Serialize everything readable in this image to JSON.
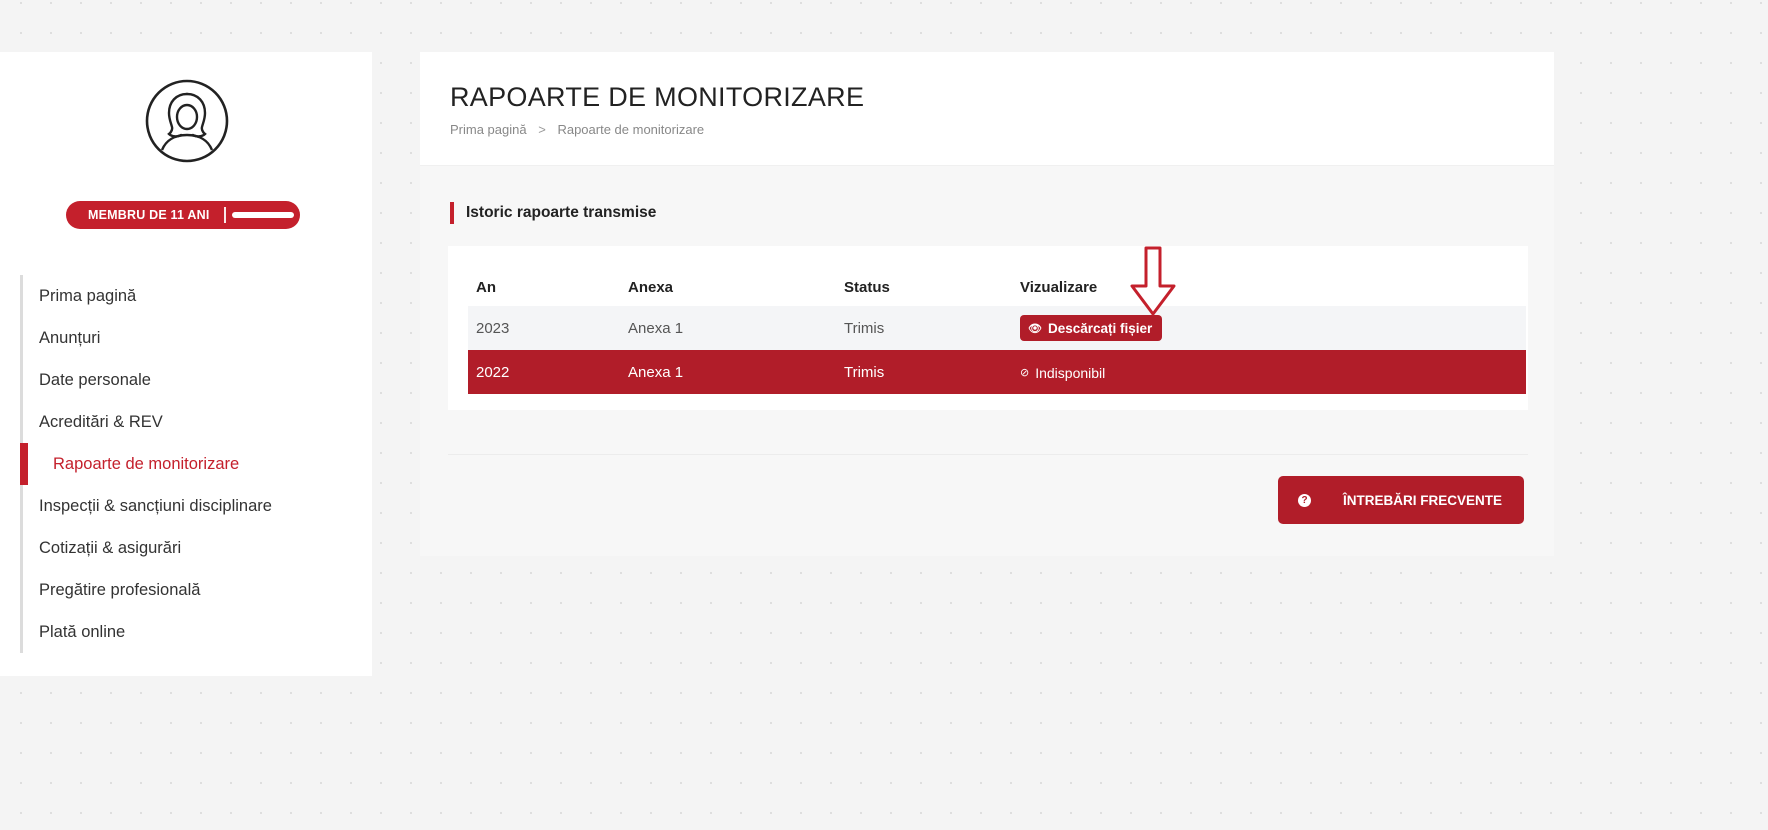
{
  "sidebar": {
    "member_badge": "MEMBRU DE 11 ANI",
    "items": [
      {
        "label": "Prima pagină",
        "active": false
      },
      {
        "label": "Anunțuri",
        "active": false
      },
      {
        "label": "Date personale",
        "active": false
      },
      {
        "label": "Acreditări & REV",
        "active": false
      },
      {
        "label": "Rapoarte de monitorizare",
        "active": true
      },
      {
        "label": "Inspecții & sancțiuni disciplinare",
        "active": false
      },
      {
        "label": "Cotizații & asigurări",
        "active": false
      },
      {
        "label": "Pregătire profesională",
        "active": false
      },
      {
        "label": "Plată online",
        "active": false
      }
    ]
  },
  "header": {
    "title": "RAPOARTE DE MONITORIZARE",
    "breadcrumb": {
      "home": "Prima pagină",
      "separator": ">",
      "current": "Rapoarte de monitorizare"
    }
  },
  "section": {
    "title": "Istoric rapoarte transmise"
  },
  "table": {
    "columns": [
      "An",
      "Anexa",
      "Status",
      "Vizualizare"
    ],
    "rows": [
      {
        "an": "2023",
        "anexa": "Anexa 1",
        "status": "Trimis",
        "action": "Descărcați fișier",
        "available": true
      },
      {
        "an": "2022",
        "anexa": "Anexa 1",
        "status": "Trimis",
        "action": "Indisponibil",
        "available": false
      }
    ]
  },
  "faq": {
    "icon": "?",
    "label": "ÎNTREBĂRI FRECVENTE"
  },
  "colors": {
    "accent": "#c4202c",
    "dark_accent": "#b11d29",
    "page_bg": "#f4f4f4"
  }
}
